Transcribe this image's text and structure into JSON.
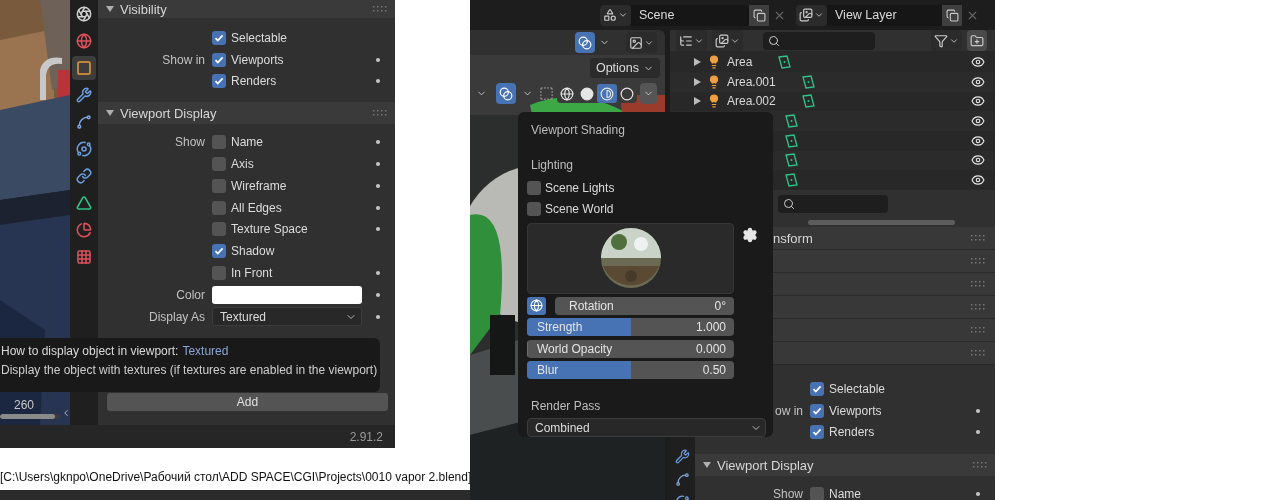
{
  "left_window": {
    "property_tabs": [
      {
        "kind": "scene",
        "selected": false
      },
      {
        "kind": "world",
        "selected": false
      },
      {
        "kind": "object",
        "selected": true
      },
      {
        "kind": "modifiers",
        "selected": false
      },
      {
        "kind": "particles",
        "selected": false
      },
      {
        "kind": "physics",
        "selected": false
      },
      {
        "kind": "constraints",
        "selected": false
      },
      {
        "kind": "data",
        "selected": false
      },
      {
        "kind": "material",
        "selected": false
      },
      {
        "kind": "texture",
        "selected": false
      }
    ],
    "sections": [
      {
        "title": "Visibility",
        "expanded": true,
        "rows": [
          {
            "kind": "checkbox",
            "text": "Selectable",
            "checked": true,
            "keyframe_dot": false
          },
          {
            "kind": "checkbox",
            "label": "Show in",
            "text": "Viewports",
            "checked": true,
            "keyframe_dot": true
          },
          {
            "kind": "checkbox",
            "text": "Renders",
            "checked": true,
            "keyframe_dot": true
          }
        ]
      },
      {
        "title": "Viewport Display",
        "expanded": true,
        "rows": [
          {
            "kind": "checkbox",
            "label": "Show",
            "text": "Name",
            "checked": false,
            "keyframe_dot": true
          },
          {
            "kind": "checkbox",
            "text": "Axis",
            "checked": false,
            "keyframe_dot": true
          },
          {
            "kind": "checkbox",
            "text": "Wireframe",
            "checked": false,
            "keyframe_dot": true
          },
          {
            "kind": "checkbox",
            "text": "All Edges",
            "checked": false,
            "keyframe_dot": true
          },
          {
            "kind": "checkbox",
            "text": "Texture Space",
            "checked": false,
            "keyframe_dot": true
          },
          {
            "kind": "checkbox",
            "text": "Shadow",
            "checked": true,
            "keyframe_dot": false
          },
          {
            "kind": "checkbox",
            "text": "In Front",
            "checked": false,
            "keyframe_dot": true
          },
          {
            "kind": "color",
            "label": "Color",
            "color": "#ffffff",
            "keyframe_dot": true
          },
          {
            "kind": "dropdown",
            "label": "Display As",
            "value": "Textured",
            "keyframe_dot": true
          }
        ]
      }
    ],
    "add_button": "Add",
    "frame": "260",
    "frame_slider": {
      "level": 0.92
    },
    "version": "2.91.2",
    "tooltip": {
      "title": "How to display object in viewport:",
      "value": "Textured",
      "description": "Display the object with textures (if textures are enabled in the viewport)"
    }
  },
  "file_path": "[C:\\Users\\gknpo\\OneDrive\\Рабочий стол\\ADD SPACE\\CGI\\Projects\\0010 vapor 2.blend]",
  "right_window": {
    "scene": "Scene",
    "view_layer": "View Layer",
    "viewport": {
      "options_button": "Options",
      "shading_modes": [
        {
          "kind": "wireframe",
          "selected": false
        },
        {
          "kind": "solid",
          "selected": false
        },
        {
          "kind": "material",
          "selected": true
        },
        {
          "kind": "rendered",
          "selected": false
        }
      ]
    },
    "outliner": {
      "rows": [
        {
          "kind": "light",
          "name": "Area"
        },
        {
          "kind": "light",
          "name": "Area.001"
        },
        {
          "kind": "light",
          "name": "Area.002"
        },
        {
          "kind": "covered"
        },
        {
          "kind": "covered"
        },
        {
          "kind": "covered"
        },
        {
          "kind": "covered"
        }
      ]
    },
    "shading_popover": {
      "title": "Viewport Shading",
      "lighting_label": "Lighting",
      "toggles": [
        {
          "text": "Scene Lights",
          "checked": false
        },
        {
          "text": "Scene World",
          "checked": false
        }
      ],
      "rotation": {
        "label": "Rotation",
        "reading": "0°"
      },
      "sliders": [
        {
          "label": "Strength",
          "level": 0.5,
          "reading": "1.000"
        },
        {
          "label": "World Opacity",
          "level": 0,
          "reading": "0.000"
        },
        {
          "label": "Blur",
          "level": 0.5,
          "reading": "0.50"
        }
      ],
      "render_pass_label": "Render Pass",
      "render_pass": "Combined"
    },
    "properties": {
      "collapsed_headers": [
        {
          "kind": "panel",
          "title": "nsform"
        },
        {
          "kind": "panel"
        },
        {
          "kind": "panel"
        },
        {
          "kind": "panel"
        },
        {
          "kind": "panel"
        },
        {
          "kind": "panel"
        }
      ],
      "sections": [
        {
          "rows": [
            {
              "kind": "checkbox",
              "text": "Selectable",
              "checked": true,
              "keyframe_dot": false
            },
            {
              "kind": "checkbox",
              "label": "ow in",
              "text": "Viewports",
              "checked": true,
              "keyframe_dot": true
            },
            {
              "kind": "checkbox",
              "text": "Renders",
              "checked": true,
              "keyframe_dot": true
            }
          ]
        },
        {
          "title": "Viewport Display",
          "expanded": true,
          "rows": [
            {
              "kind": "checkbox",
              "label": "Show",
              "text": "Name",
              "checked": false,
              "keyframe_dot": true
            }
          ]
        }
      ]
    }
  }
}
